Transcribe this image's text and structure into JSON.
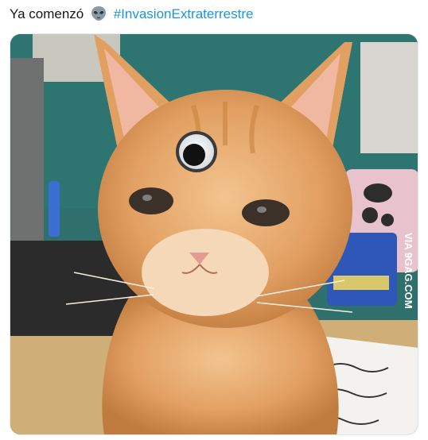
{
  "tweet": {
    "text_prefix": "Ya comenzó",
    "emoji": "alien-face-icon",
    "hashtag": "#InvasionExtraterrestre"
  },
  "media": {
    "alt": "kitten-with-googly-eye-photo",
    "watermark": "VIA 9GAG.COM"
  },
  "colors": {
    "text": "#14171a",
    "link": "#1b95e0",
    "border": "#e1e8ed"
  }
}
